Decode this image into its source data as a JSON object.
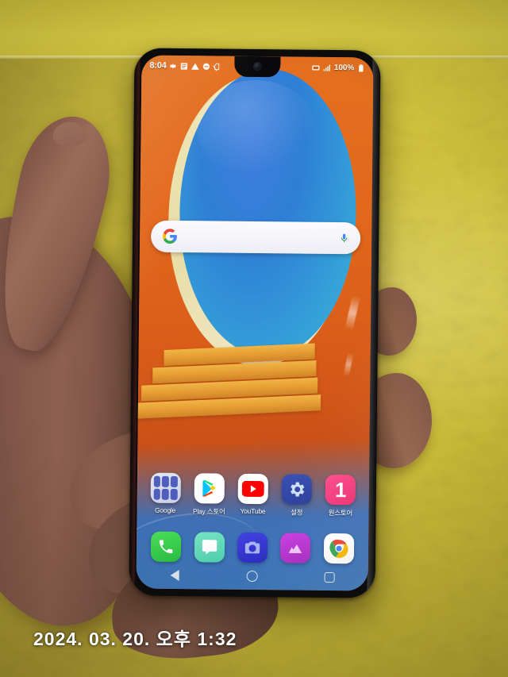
{
  "photo": {
    "timestamp_overlay": "2024. 03. 20. 오후 1:32",
    "subject": "hand-holding-smartphone",
    "background_color": "#d2c63f",
    "hand_color": "#8a5e4e"
  },
  "phone": {
    "body_color": "#0b0b0d",
    "notch": "waterdrop-notch",
    "camera": "front-camera"
  },
  "status_bar": {
    "time": "8:04",
    "battery_percent": "100%",
    "left_icons": [
      "settings-icon",
      "list-icon",
      "warning-icon",
      "dnd-icon",
      "no-sim-icon"
    ],
    "right_icons": [
      "sd-card-icon",
      "signal-icon",
      "battery-icon"
    ]
  },
  "search_widget": {
    "logo": "google-g-logo",
    "mic": "microphone-icon",
    "placeholder": ""
  },
  "app_grid": [
    {
      "label": "Google",
      "icon": "google-folder-icon",
      "color": "#d6dbef"
    },
    {
      "label": "Play 스토어",
      "icon": "play-store-icon",
      "color": "#ffffff"
    },
    {
      "label": "YouTube",
      "icon": "youtube-icon",
      "color": "#ff0000"
    },
    {
      "label": "설정",
      "icon": "settings-gear-icon",
      "color": "#3b52b5"
    },
    {
      "label": "원스토어",
      "icon": "one-store-icon",
      "color": "#ff4d8d",
      "badge": "1"
    }
  ],
  "dock": [
    {
      "name": "phone",
      "icon": "phone-icon",
      "color": "#3ad14c"
    },
    {
      "name": "messages",
      "icon": "message-bubble-icon",
      "color": "#5fd8ba"
    },
    {
      "name": "camera",
      "icon": "camera-icon",
      "color": "#3536d2"
    },
    {
      "name": "gallery",
      "icon": "gallery-icon",
      "color": "#b833d2"
    },
    {
      "name": "chrome",
      "icon": "chrome-icon",
      "color": "#ffffff"
    }
  ],
  "nav_bar": [
    {
      "name": "back",
      "icon": "back-triangle-icon"
    },
    {
      "name": "home",
      "icon": "home-circle-icon"
    },
    {
      "name": "recents",
      "icon": "recents-square-icon"
    }
  ],
  "wallpaper": {
    "description": "abstract-orange-blue-ellipse",
    "ellipse_color": "#3582d8",
    "rim_color": "#eee3ae",
    "base_top": "#e4701f",
    "base_bottom": "#3d79c0"
  }
}
